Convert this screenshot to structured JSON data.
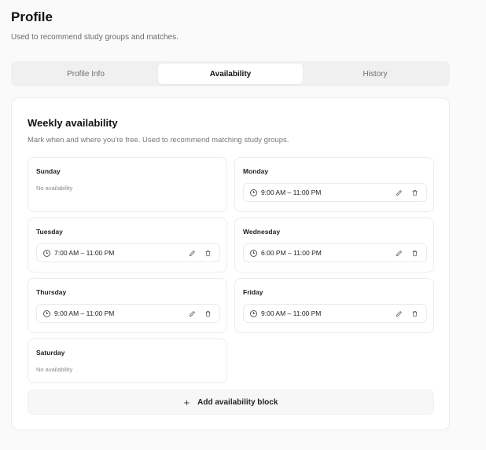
{
  "header": {
    "title": "Profile",
    "subtitle": "Used to recommend study groups and matches."
  },
  "tabs": [
    {
      "label": "Profile Info",
      "active": false
    },
    {
      "label": "Availability",
      "active": true
    },
    {
      "label": "History",
      "active": false
    }
  ],
  "availability": {
    "title": "Weekly availability",
    "description": "Mark when and where you're free. Used to recommend matching study groups.",
    "days": [
      {
        "name": "Sunday",
        "empty_text": "No availability"
      },
      {
        "name": "Monday",
        "slot": "9:00 AM – 11:00 PM"
      },
      {
        "name": "Tuesday",
        "slot": "7:00 AM – 11:00 PM"
      },
      {
        "name": "Wednesday",
        "slot": "6:00 PM – 11:00 PM"
      },
      {
        "name": "Thursday",
        "slot": "9:00 AM – 11:00 PM"
      },
      {
        "name": "Friday",
        "slot": "9:00 AM – 11:00 PM"
      },
      {
        "name": "Saturday",
        "empty_text": "No availability"
      }
    ],
    "add_button_label": "Add availability block"
  },
  "icons": {
    "clock": "clock-icon",
    "edit": "pencil-icon",
    "delete": "trash-icon",
    "add": "plus-icon"
  }
}
